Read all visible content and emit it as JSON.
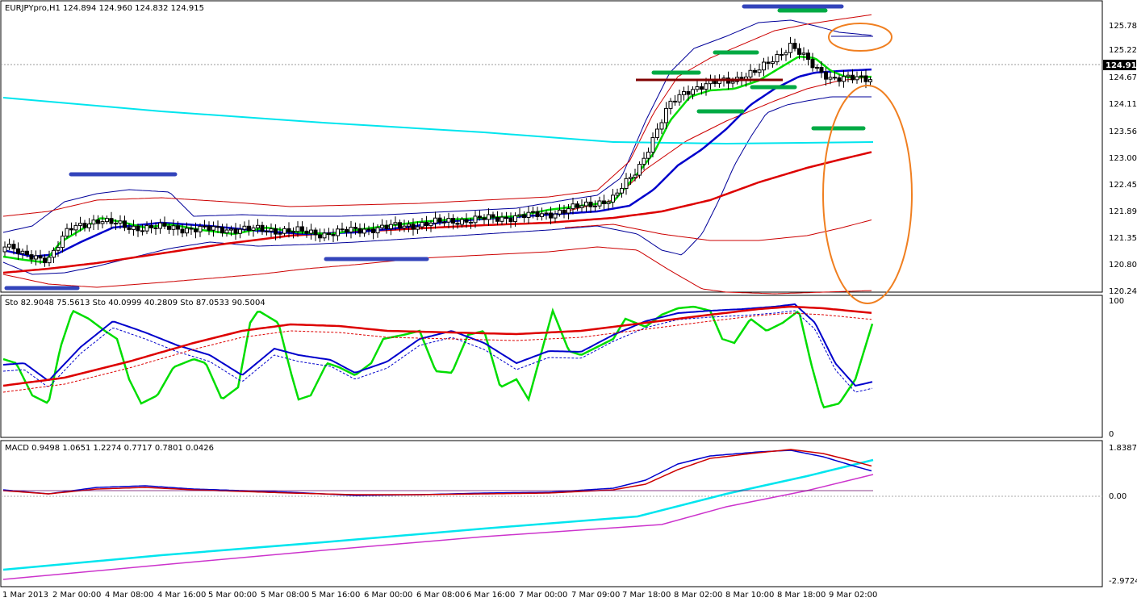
{
  "chart_data": {
    "type": "line",
    "panels": {
      "main": {
        "header": "EURJPYpro,H1  124.894 124.960 124.832 124.915",
        "ylim": [
          120.0,
          126.5
        ],
        "yticks": [
          "125.780",
          "125.225",
          "124.670",
          "124.115",
          "123.560",
          "123.005",
          "122.450",
          "121.895",
          "121.355",
          "120.800",
          "120.245"
        ],
        "current_price": "124.915",
        "colors": {
          "bull_body": "#ffffff",
          "bear_body": "#000000",
          "wick": "#000000",
          "ma_fast": "#00dd00",
          "ma_mid": "#0000cc",
          "ma_slow": "#dd0000",
          "ma_long": "#00e5ee",
          "bb_outer": "#cc0000",
          "bb_inner": "#000099",
          "support_levels": "#00aa44",
          "resistance_zone": "#3344bb",
          "horizontal_level": "#800000",
          "highlight_circle": "#f07f20"
        }
      },
      "stochastic": {
        "header": "Sto 82.9048 75.5613  Sto 40.0999 40.2809  Sto 87.0533 90.5004",
        "ylim": [
          0,
          100
        ],
        "yticks": [
          "100",
          "0"
        ]
      },
      "macd": {
        "header": "MACD 0.9498 1.0651 1.2274 0.7717 0.7801 0.0426",
        "ylim": [
          -2.9724,
          1.8387
        ],
        "yticks": [
          "1.8387",
          "0.00",
          "-2.9724"
        ]
      }
    },
    "x_labels": [
      "1 Mar 2013",
      "2 Mar 00:00",
      "4 Mar 08:00",
      "4 Mar 16:00",
      "5 Mar 00:00",
      "5 Mar 08:00",
      "5 Mar 16:00",
      "6 Mar 00:00",
      "6 Mar 08:00",
      "6 Mar 16:00",
      "7 Mar 00:00",
      "7 Mar 09:00",
      "7 Mar 18:00",
      "8 Mar 02:00",
      "8 Mar 10:00",
      "8 Mar 18:00",
      "9 Mar 02:00"
    ],
    "grid": false
  }
}
